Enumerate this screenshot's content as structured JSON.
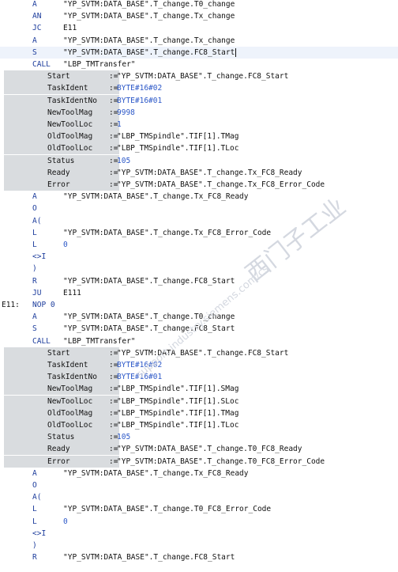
{
  "lines": [
    {
      "label": "",
      "op": "A",
      "arg": "\"YP_SVTM:DATA_BASE\".T_change.T0_change"
    },
    {
      "label": "",
      "op": "AN",
      "arg": "\"YP_SVTM:DATA_BASE\".T_change.Tx_change"
    },
    {
      "label": "",
      "op": "JC",
      "arg": "E11"
    },
    {
      "label": "",
      "op": "A",
      "arg": "\"YP_SVTM:DATA_BASE\".T_change.Tx_change"
    },
    {
      "label": "",
      "op": "S",
      "arg": "\"YP_SVTM:DATA_BASE\".T_change.FC8_Start"
    },
    {
      "label": "",
      "op": "CALL",
      "arg": "\"LBP_TMTransfer\""
    },
    {
      "param": "Start",
      "value": "\"YP_SVTM:DATA_BASE\".T_change.FC8_Start",
      "blue": false
    },
    {
      "param": "TaskIdent",
      "value": "BYTE#16#02",
      "blue": true
    },
    {
      "param": "TaskIdentNo",
      "value": "BYTE#16#01",
      "blue": true
    },
    {
      "param": "NewToolMag",
      "value": "9998",
      "blue": true
    },
    {
      "param": "NewToolLoc",
      "value": "1",
      "blue": true
    },
    {
      "param": "OldToolMag",
      "value": "\"LBP_TMSpindle\".TIF[1].TMag",
      "blue": false
    },
    {
      "param": "OldToolLoc",
      "value": "\"LBP_TMSpindle\".TIF[1].TLoc",
      "blue": false
    },
    {
      "param": "Status",
      "value": "105",
      "blue": true
    },
    {
      "param": "Ready",
      "value": "\"YP_SVTM:DATA_BASE\".T_change.Tx_FC8_Ready",
      "blue": false
    },
    {
      "param": "Error",
      "value": "\"YP_SVTM:DATA_BASE\".T_change.Tx_FC8_Error_Code",
      "blue": false
    },
    {
      "label": "",
      "op": "A",
      "arg": "\"YP_SVTM:DATA_BASE\".T_change.Tx_FC8_Ready"
    },
    {
      "label": "",
      "op": "O",
      "arg": ""
    },
    {
      "label": "",
      "op": "A(",
      "arg": ""
    },
    {
      "label": "",
      "op": "L",
      "arg": "\"YP_SVTM:DATA_BASE\".T_change.Tx_FC8_Error_Code"
    },
    {
      "label": "",
      "op": "L",
      "arg": "0",
      "argBlue": true
    },
    {
      "label": "",
      "op": "<>I",
      "arg": ""
    },
    {
      "label": "",
      "op": ")",
      "arg": ""
    },
    {
      "label": "",
      "op": "R",
      "arg": "\"YP_SVTM:DATA_BASE\".T_change.FC8_Start"
    },
    {
      "label": "",
      "op": "JU",
      "arg": "E111"
    },
    {
      "label": "E11:",
      "op": "NOP 0",
      "arg": ""
    },
    {
      "label": "",
      "op": "A",
      "arg": "\"YP_SVTM:DATA_BASE\".T_change.T0_change"
    },
    {
      "label": "",
      "op": "S",
      "arg": "\"YP_SVTM:DATA_BASE\".T_change.FC8_Start"
    },
    {
      "label": "",
      "op": "CALL",
      "arg": "\"LBP_TMTransfer\""
    },
    {
      "param": "Start",
      "value": "\"YP_SVTM:DATA_BASE\".T_change.FC8_Start",
      "blue": false
    },
    {
      "param": "TaskIdent",
      "value": "BYTE#16#02",
      "blue": true
    },
    {
      "param": "TaskIdentNo",
      "value": "BYTE#16#01",
      "blue": true
    },
    {
      "param": "NewToolMag",
      "value": "\"LBP_TMSpindle\".TIF[1].SMag",
      "blue": false
    },
    {
      "param": "NewToolLoc",
      "value": "\"LBP_TMSpindle\".TIF[1].SLoc",
      "blue": false
    },
    {
      "param": "OldToolMag",
      "value": "\"LBP_TMSpindle\".TIF[1].TMag",
      "blue": false
    },
    {
      "param": "OldToolLoc",
      "value": "\"LBP_TMSpindle\".TIF[1].TLoc",
      "blue": false
    },
    {
      "param": "Status",
      "value": "105",
      "blue": true
    },
    {
      "param": "Ready",
      "value": "\"YP_SVTM:DATA_BASE\".T_change.T0_FC8_Ready",
      "blue": false
    },
    {
      "param": "Error",
      "value": "\"YP_SVTM:DATA_BASE\".T_change.T0_FC8_Error_Code",
      "blue": false
    },
    {
      "label": "",
      "op": "A",
      "arg": "\"YP_SVTM:DATA_BASE\".T_change.Tx_FC8_Ready"
    },
    {
      "label": "",
      "op": "O",
      "arg": ""
    },
    {
      "label": "",
      "op": "A(",
      "arg": ""
    },
    {
      "label": "",
      "op": "L",
      "arg": "\"YP_SVTM:DATA_BASE\".T_change.T0_FC8_Error_Code"
    },
    {
      "label": "",
      "op": "L",
      "arg": "0",
      "argBlue": true
    },
    {
      "label": "",
      "op": "<>I",
      "arg": ""
    },
    {
      "label": "",
      "op": ")",
      "arg": ""
    },
    {
      "label": "",
      "op": "R",
      "arg": "\"YP_SVTM:DATA_BASE\".T_change.FC8_Start"
    }
  ],
  "assign_symbol": ":=",
  "highlighted_line": 4,
  "watermark": {
    "logo": "西门子工业",
    "site": "support.industry.siemens.com/cs"
  }
}
